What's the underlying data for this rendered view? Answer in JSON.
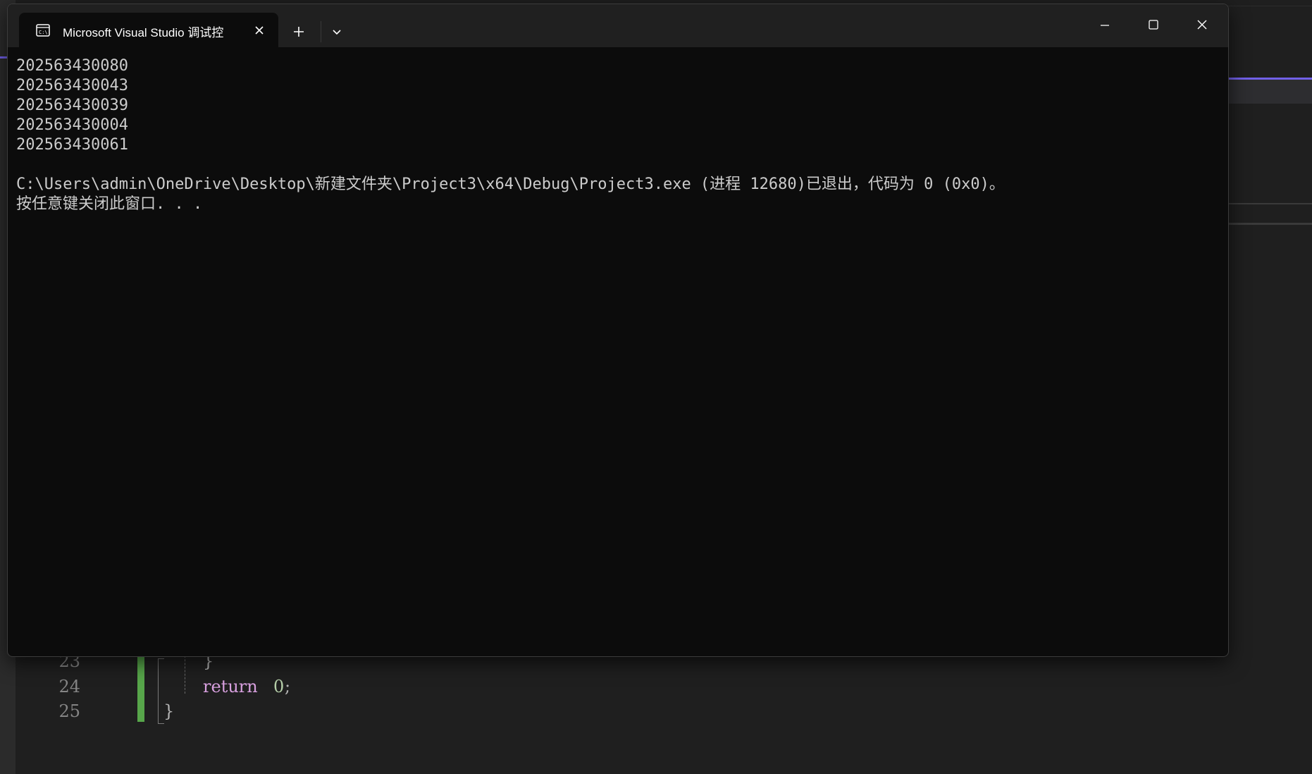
{
  "terminal": {
    "tab_title": "Microsoft Visual Studio 调试控",
    "output_lines": [
      "202563430080",
      "202563430043",
      "202563430039",
      "202563430004",
      "202563430061"
    ],
    "exit_message": "C:\\Users\\admin\\OneDrive\\Desktop\\新建文件夹\\Project3\\x64\\Debug\\Project3.exe (进程 12680)已退出，代码为 0 (0x0)。",
    "press_key_message": "按任意键关闭此窗口. . ."
  },
  "editor": {
    "lines": [
      {
        "number": "23",
        "code": "}"
      },
      {
        "number": "24",
        "keyword": "return",
        "value": "0",
        "terminator": ";"
      },
      {
        "number": "25",
        "code": "}"
      }
    ]
  },
  "colors": {
    "terminal_bg": "#0c0c0c",
    "titlebar_bg": "#202020",
    "console_text": "#cccccc",
    "keyword": "#d8a0df",
    "number": "#b5cea8",
    "change_bar": "#57a64a",
    "accent": "#7160e8"
  },
  "icons": {
    "tab": "console-icon",
    "close": "close-icon",
    "new_tab": "plus-icon",
    "dropdown": "chevron-down-icon",
    "minimize": "minimize-icon",
    "maximize": "maximize-icon",
    "window_close": "window-close-icon"
  }
}
